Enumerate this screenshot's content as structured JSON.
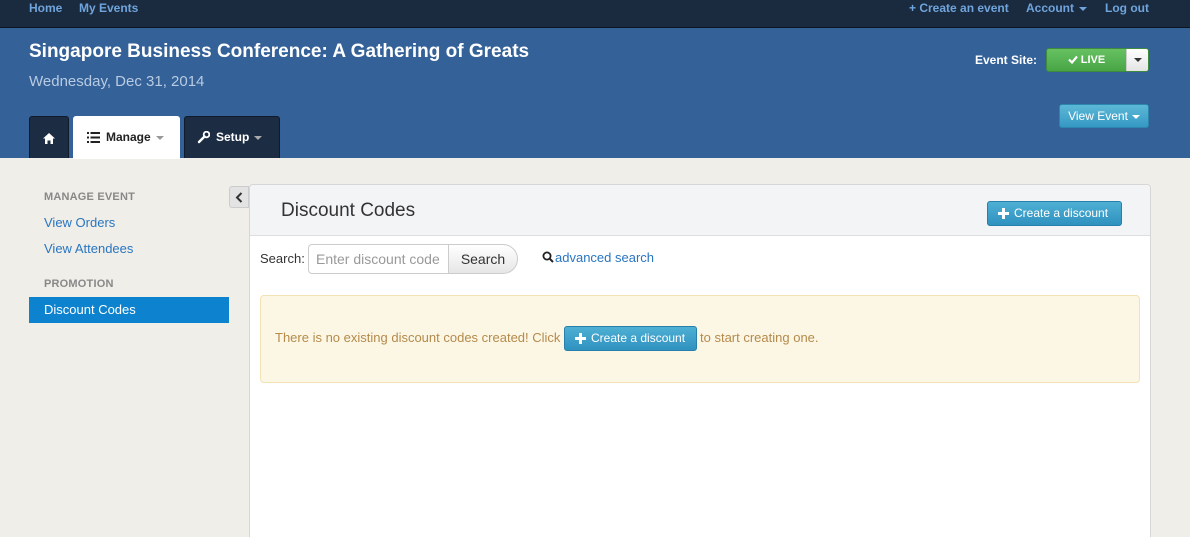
{
  "topnav": {
    "home": "Home",
    "my_events": "My Events",
    "create_event": "+ Create an event",
    "account": "Account",
    "logout": "Log out"
  },
  "event": {
    "title": "Singapore Business Conference: A Gathering of Greats",
    "date": "Wednesday, Dec 31, 2014"
  },
  "event_site": {
    "label": "Event Site:",
    "status": "LIVE",
    "status_color": "#52b04d"
  },
  "view_event_label": "View Event",
  "tabs": {
    "manage": "Manage",
    "setup": "Setup"
  },
  "sidebar": {
    "manage_heading": "MANAGE EVENT",
    "view_orders": "View Orders",
    "view_attendees": "View Attendees",
    "promotion_heading": "PROMOTION",
    "discount_codes": "Discount Codes"
  },
  "main": {
    "title": "Discount Codes",
    "create_discount": "Create a discount",
    "search_label": "Search:",
    "search_placeholder": "Enter discount code",
    "search_button": "Search",
    "advanced_search": "advanced search",
    "alert_before": "There is no existing discount codes created! Click",
    "alert_button": "Create a discount",
    "alert_after": "to start creating one."
  },
  "colors": {
    "accent_blue": "#336198",
    "link": "#2a75c0",
    "active_nav": "#0d83cf",
    "alert_bg": "#fcf7e4"
  }
}
